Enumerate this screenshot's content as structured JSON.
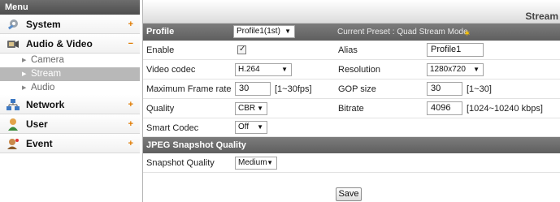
{
  "sidebar": {
    "header": "Menu",
    "categories": {
      "system": {
        "label": "System",
        "toggle": "+",
        "icon": "gear-icon"
      },
      "audio_video": {
        "label": "Audio & Video",
        "toggle": "−",
        "icon": "audio-video-icon",
        "items": {
          "camera": "Camera",
          "stream": "Stream",
          "audio": "Audio"
        }
      },
      "network": {
        "label": "Network",
        "toggle": "+",
        "icon": "network-icon"
      },
      "user": {
        "label": "User",
        "toggle": "+",
        "icon": "user-icon"
      },
      "event": {
        "label": "Event",
        "toggle": "+",
        "icon": "event-icon"
      }
    },
    "active_item": "Stream"
  },
  "main": {
    "title": "Stream",
    "profile_section": {
      "label": "Profile",
      "selected_profile": "Profile1(1st)",
      "current_preset": "Current Preset : Quad Stream Mode"
    },
    "fields": {
      "enable": {
        "label": "Enable",
        "checked": true,
        "check_glyph": "✓"
      },
      "alias": {
        "label": "Alias",
        "value": "Profile1"
      },
      "video_codec": {
        "label": "Video codec",
        "value": "H.264"
      },
      "resolution": {
        "label": "Resolution",
        "value": "1280x720"
      },
      "max_frame_rate": {
        "label": "Maximum Frame rate",
        "value": "30",
        "range": "[1~30fps]"
      },
      "gop_size": {
        "label": "GOP size",
        "value": "30",
        "range": "[1~30]"
      },
      "quality": {
        "label": "Quality",
        "value": "CBR"
      },
      "bitrate": {
        "label": "Bitrate",
        "value": "4096",
        "range": "[1024~10240 kbps]"
      },
      "smart_codec": {
        "label": "Smart Codec",
        "value": "Off"
      }
    },
    "jpeg_section": {
      "label": "JPEG Snapshot Quality",
      "snapshot_quality": {
        "label": "Snapshot Quality",
        "value": "Medium"
      }
    },
    "save_label": "Save"
  },
  "colors": {
    "section_bar": "#6e6e6e",
    "active_item_bg": "#b8b8b8",
    "toggle_accent": "#e07a00",
    "preset_icon": "#ffc400"
  }
}
